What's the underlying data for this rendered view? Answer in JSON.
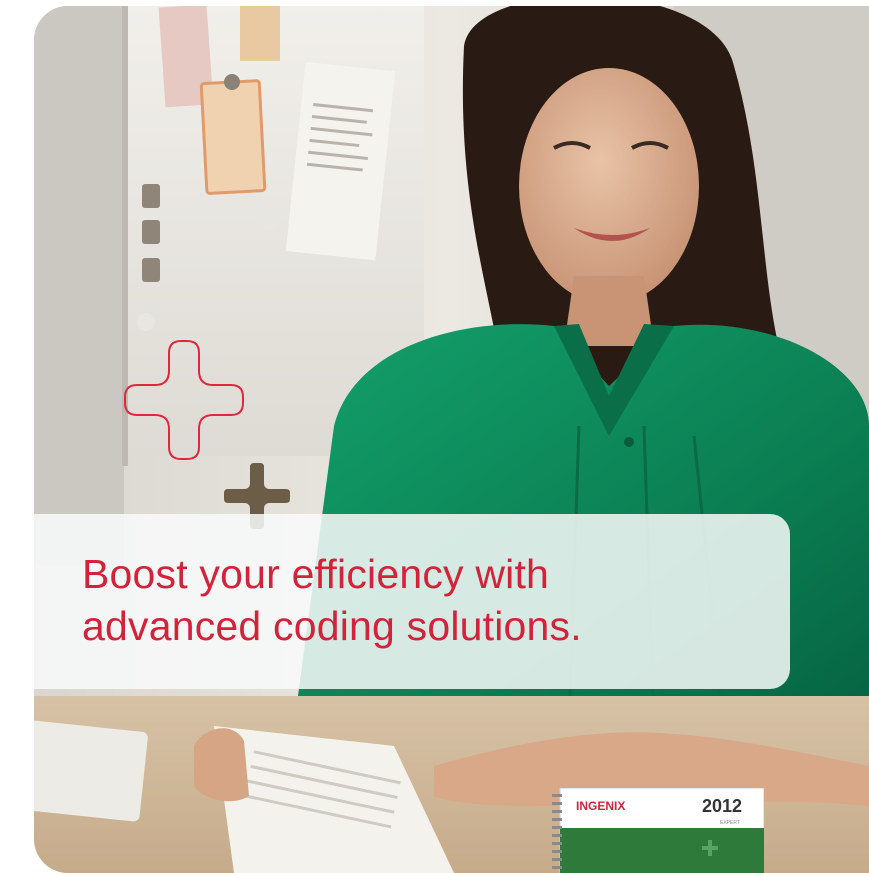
{
  "headline": {
    "line1": "Boost your efficiency with",
    "line2": "advanced coding solutions."
  },
  "product": {
    "brand": "INGENIX",
    "year": "2012",
    "edition": "EXPERT"
  },
  "colors": {
    "headline_red": "#d3233b",
    "cross_outline_red": "#e0273f",
    "cross_solid_brown": "#6b5d48",
    "book_green": "#2e7a3a",
    "shirt_green": "#0f8a5c"
  }
}
